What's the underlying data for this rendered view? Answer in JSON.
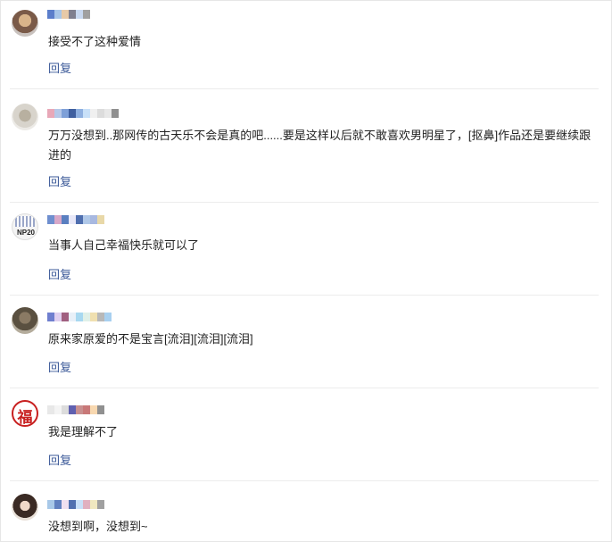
{
  "comments": [
    {
      "text": "接受不了这种爱情",
      "reply": "回复",
      "name_pixels": [
        "#5b7ecb",
        "#a7c5e8",
        "#e7c9a7",
        "#7f7f8f",
        "#c8d8f0",
        "#a0a0a0"
      ]
    },
    {
      "text": "万万没想到..那网传的古天乐不会是真的吧......要是这样以后就不敢喜欢男明星了，[抠鼻]作品还是要继续跟进的",
      "reply": "回复",
      "name_pixels": [
        "#e8a8b8",
        "#b5c8e8",
        "#7ea0d8",
        "#3f5f9f",
        "#8fb0e0",
        "#c8e0f8",
        "#f0f0f0",
        "#dcdcdc",
        "#e8e8e8",
        "#909090"
      ]
    },
    {
      "text": "当事人自己幸福快乐就可以了",
      "reply": "回复",
      "name_pixels": [
        "#6f8fcf",
        "#d8a8c8",
        "#5a7fc0",
        "#e8e8f8",
        "#4f6faf",
        "#b0c8e8",
        "#a8b8e0",
        "#e8d8a8"
      ]
    },
    {
      "text": "原来家原爱的不是宝言[流泪][流泪][流泪]",
      "reply": "回复",
      "name_pixels": [
        "#6f7fcf",
        "#e0d0f0",
        "#a06080",
        "#e8f0f8",
        "#a8d8f0",
        "#e0f0e8",
        "#f0e0b0",
        "#b8b8b8",
        "#a8d0f0"
      ]
    },
    {
      "text": "我是理解不了",
      "reply": "回复",
      "name_pixels": [
        "#e8e8e8",
        "#f4f4f4",
        "#dcdcdc",
        "#6060b0",
        "#c89090",
        "#c87878",
        "#f8d8b0",
        "#909090"
      ]
    },
    {
      "text": "没想到啊，没想到~",
      "reply": "",
      "name_pixels": [
        "#a8c8e8",
        "#6080c0",
        "#f0e0f0",
        "#5070b0",
        "#c8e0f8",
        "#e0b0c0",
        "#f0e8c0",
        "#a0a0a0"
      ]
    }
  ],
  "avatars": [
    "woman-blonde-avatar",
    "grey-portrait-avatar",
    "np20-logo-avatar",
    "dark-portrait-avatar",
    "fu-character-avatar",
    "woman-portrait-avatar"
  ],
  "avatar_fu_char": "福",
  "avatar_np_text": "NP20"
}
